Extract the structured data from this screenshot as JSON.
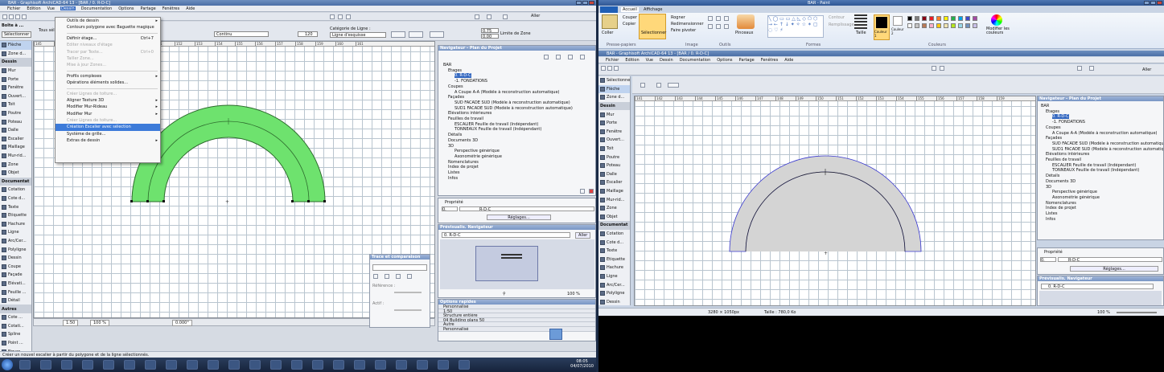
{
  "left_window": {
    "title": "BAR - Graphisoft ArchiCAD-64 13 - [BAR / 0. R-D-C]",
    "menu": [
      "Fichier",
      "Edition",
      "Vue",
      "Dessin",
      "Documentation",
      "Options",
      "Partage",
      "Fenêtres",
      "Aide"
    ],
    "active_menu": "Dessin",
    "infobox": {
      "title": "Boîte à ...",
      "select_btn": "Sélectionner",
      "tous_sele": "Tous séle",
      "line_type": "Continu",
      "thickness": "120",
      "category_label": "Catégorie de Ligne :",
      "category_value": "Ligne d'esquisse",
      "zone_limit": "Limite de Zone",
      "value_1": "0.75",
      "value_2": "0.00",
      "goto": "Aller"
    },
    "toolbox": [
      {
        "label": "Flèche",
        "type": "tool",
        "sel": true
      },
      {
        "label": "Zone d...",
        "type": "tool"
      },
      {
        "label": "Dessin",
        "type": "sec"
      },
      {
        "label": "Mur",
        "type": "tool"
      },
      {
        "label": "Porte",
        "type": "tool"
      },
      {
        "label": "Fenêtre",
        "type": "tool"
      },
      {
        "label": "Ouvert...",
        "type": "tool"
      },
      {
        "label": "Toit",
        "type": "tool"
      },
      {
        "label": "Poutre",
        "type": "tool"
      },
      {
        "label": "Poteau",
        "type": "tool"
      },
      {
        "label": "Dalle",
        "type": "tool"
      },
      {
        "label": "Escalier",
        "type": "tool"
      },
      {
        "label": "Maillage",
        "type": "tool"
      },
      {
        "label": "Mur-rid...",
        "type": "tool"
      },
      {
        "label": "Zone",
        "type": "tool"
      },
      {
        "label": "Objet",
        "type": "tool"
      },
      {
        "label": "Documentat",
        "type": "sec"
      },
      {
        "label": "Cotation",
        "type": "tool"
      },
      {
        "label": "Cote d...",
        "type": "tool"
      },
      {
        "label": "Texte",
        "type": "tool"
      },
      {
        "label": "Etiquette",
        "type": "tool"
      },
      {
        "label": "Hachure",
        "type": "tool"
      },
      {
        "label": "Ligne",
        "type": "tool"
      },
      {
        "label": "Arc/Cer...",
        "type": "tool"
      },
      {
        "label": "Polyligne",
        "type": "tool"
      },
      {
        "label": "Dessin",
        "type": "tool"
      },
      {
        "label": "Coupe",
        "type": "tool"
      },
      {
        "label": "Façade",
        "type": "tool"
      },
      {
        "label": "Elévati...",
        "type": "tool"
      },
      {
        "label": "Feuille ...",
        "type": "tool"
      },
      {
        "label": "Détail",
        "type": "tool"
      },
      {
        "label": "Autres",
        "type": "sec"
      },
      {
        "label": "Cote ...",
        "type": "tool"
      },
      {
        "label": "Cotati...",
        "type": "tool"
      },
      {
        "label": "Spline",
        "type": "tool"
      },
      {
        "label": "Point ...",
        "type": "tool"
      },
      {
        "label": "Figure",
        "type": "tool"
      }
    ],
    "dropdown": [
      {
        "label": "Outils de dessin",
        "arrow": true
      },
      {
        "label": "Contours polygone avec Baguette magique"
      },
      {
        "sep": true
      },
      {
        "label": "Définir étage...",
        "key": "Ctrl+7"
      },
      {
        "label": "Editer niveaux d'étage",
        "dis": true
      },
      {
        "label": "Tracer par Texte...",
        "key": "Ctrl+0",
        "dis": true
      },
      {
        "label": "Tailler Zone...",
        "dis": true
      },
      {
        "label": "Mise à jour Zones...",
        "dis": true
      },
      {
        "sep": true
      },
      {
        "label": "Profils complexes",
        "arrow": true
      },
      {
        "label": "Opérations éléments solides..."
      },
      {
        "sep": true
      },
      {
        "label": "Créer Lignes de toiture...",
        "dis": true
      },
      {
        "label": "Aligner Texture 3D",
        "arrow": true
      },
      {
        "label": "Modifier Mur-Rideau",
        "arrow": true
      },
      {
        "label": "Modifier Mur",
        "arrow": true
      },
      {
        "label": "Créer Lignes de toiture...",
        "dis": true
      },
      {
        "label": "Création Escalier avec sélection",
        "hl": true
      },
      {
        "label": "Système de grille..."
      },
      {
        "label": "Extras de dessin",
        "arrow": true
      }
    ],
    "ruler": [
      "145",
      "146",
      "147",
      "148",
      "149",
      "150",
      "151",
      "152",
      "153",
      "154",
      "155",
      "156",
      "157",
      "158",
      "159",
      "160",
      "161"
    ],
    "navigator_title": "Navigateur - Plan du Projet",
    "tree": [
      {
        "t": "BAR",
        "l": 0
      },
      {
        "t": "Etages",
        "l": 1
      },
      {
        "t": "0. R-D-C",
        "l": 2,
        "hl": true
      },
      {
        "t": "-1. FONDATIONS",
        "l": 2
      },
      {
        "t": "Coupes",
        "l": 1
      },
      {
        "t": "A Coupe A-A (Modèle à reconstruction automatique)",
        "l": 2
      },
      {
        "t": "Façades",
        "l": 1
      },
      {
        "t": "SUD FACADE SUD (Modèle à reconstruction automatique)",
        "l": 2
      },
      {
        "t": "SUD1 FACADE SUD (Modèle à reconstruction automatique)",
        "l": 2
      },
      {
        "t": "Elévations intérieures",
        "l": 1
      },
      {
        "t": "Feuilles de travail",
        "l": 1
      },
      {
        "t": "ESCALIER Feuille de travail (Indépendant)",
        "l": 2
      },
      {
        "t": "TONNEAUX Feuille de travail (Indépendant)",
        "l": 2
      },
      {
        "t": "Détails",
        "l": 1
      },
      {
        "t": "Documents 3D",
        "l": 1
      },
      {
        "t": "3D",
        "l": 1
      },
      {
        "t": "Perspective générique",
        "l": 2
      },
      {
        "t": "Axonométrie générique",
        "l": 2
      },
      {
        "t": "Nomenclatures",
        "l": 1
      },
      {
        "t": "Index de projet",
        "l": 1
      },
      {
        "t": "Listes",
        "l": 1
      },
      {
        "t": "Infos",
        "l": 1
      }
    ],
    "properties": {
      "title": "Propriété",
      "name": "R-D-C",
      "floor": "0.",
      "settings_btn": "Réglages..."
    },
    "preview": {
      "title": "Prévisualis. Navigateur",
      "value": "0. R-D-C",
      "goto": "Aller",
      "zoom": "100 %"
    },
    "quick_options": {
      "title": "Options rapides",
      "rows": [
        "Personnalisé",
        "1:50",
        "Structure entière",
        "04 Building plans 50",
        "Autre",
        "Personnalisé"
      ]
    },
    "trace": {
      "title": "Trace et comparaison",
      "ref": "Référence :",
      "actif": "Actif :"
    },
    "bottom": {
      "scale": "1:50",
      "zoom": "100 %",
      "angle": "0.000°"
    },
    "status": "Créer un nouvel escalier à partir du polygone et de la ligne sélectionnés.",
    "clock_time": "08:05",
    "clock_date": "04/07/2010",
    "colors": {
      "arch_fill": "#6ee26e",
      "arch_stroke": "#2d6b2d",
      "accent": "#3d7bd9"
    }
  },
  "right_window": {
    "paint_title": "BAR - Paint",
    "ribbon_tabs": [
      "Accueil",
      "Affichage"
    ],
    "ribbon": {
      "paste": "Coller",
      "copy": "Copier",
      "cut": "Couper",
      "select": "Sélectionner",
      "crop": "Rogner",
      "resize": "Redimensionner",
      "rotate": "Faire pivoter",
      "brushes": "Pinceaux",
      "outline": "Contour",
      "fill": "Remplissage",
      "size": "Taille",
      "color1": "Couleur 1",
      "color2": "Couleur 2",
      "edit_colors": "Modifier les couleurs",
      "groups": [
        "Presse-papiers",
        "Image",
        "Outils",
        "Formes",
        "Couleurs"
      ]
    },
    "swatches": [
      "#000000",
      "#7f7f7f",
      "#880015",
      "#ed1c24",
      "#ff7f27",
      "#fff200",
      "#22b14c",
      "#00a2e8",
      "#3f48cc",
      "#a349a4",
      "#ffffff",
      "#c3c3c3",
      "#b97a57",
      "#ffaec9",
      "#ffc90e",
      "#efe4b0",
      "#b5e61d",
      "#99d9ea",
      "#7092be",
      "#c8bfe7"
    ],
    "archicad_title": "BAR - Graphisoft ArchiCAD-64 13 - [BAR / 0. R-D-C]",
    "menu": [
      "Fichier",
      "Edition",
      "Vue",
      "Dessin",
      "Documentation",
      "Options",
      "Partage",
      "Fenêtres",
      "Aide"
    ],
    "goto": "Aller",
    "toolbox": [
      {
        "label": "Sélectionner",
        "type": "tool"
      },
      {
        "label": "Flèche",
        "type": "tool",
        "sel": true
      },
      {
        "label": "Zone d...",
        "type": "tool"
      },
      {
        "label": "Dessin",
        "type": "sec"
      },
      {
        "label": "Mur",
        "type": "tool"
      },
      {
        "label": "Porte",
        "type": "tool"
      },
      {
        "label": "Fenêtre",
        "type": "tool"
      },
      {
        "label": "Ouvert...",
        "type": "tool"
      },
      {
        "label": "Toit",
        "type": "tool"
      },
      {
        "label": "Poutre",
        "type": "tool"
      },
      {
        "label": "Poteau",
        "type": "tool"
      },
      {
        "label": "Dalle",
        "type": "tool"
      },
      {
        "label": "Escalier",
        "type": "tool"
      },
      {
        "label": "Maillage",
        "type": "tool"
      },
      {
        "label": "Mur-rid...",
        "type": "tool"
      },
      {
        "label": "Zone",
        "type": "tool"
      },
      {
        "label": "Objet",
        "type": "tool"
      },
      {
        "label": "Documentat",
        "type": "sec"
      },
      {
        "label": "Cotation",
        "type": "tool"
      },
      {
        "label": "Cote d...",
        "type": "tool"
      },
      {
        "label": "Texte",
        "type": "tool"
      },
      {
        "label": "Etiquette",
        "type": "tool"
      },
      {
        "label": "Hachure",
        "type": "tool"
      },
      {
        "label": "Ligne",
        "type": "tool"
      },
      {
        "label": "Arc/Cer...",
        "type": "tool"
      },
      {
        "label": "Polyligne",
        "type": "tool"
      },
      {
        "label": "Dessin",
        "type": "tool"
      }
    ],
    "ruler": [
      "141",
      "142",
      "143",
      "144",
      "145",
      "146",
      "147",
      "148",
      "149",
      "150",
      "151",
      "152",
      "153",
      "154",
      "155",
      "156",
      "157",
      "158",
      "159"
    ],
    "navigator_title": "Navigateur - Plan du Projet",
    "tree": [
      {
        "t": "BAR",
        "l": 0
      },
      {
        "t": "Etages",
        "l": 1
      },
      {
        "t": "0. R-D-C",
        "l": 2,
        "hl": true
      },
      {
        "t": "-1. FONDATIONS",
        "l": 2
      },
      {
        "t": "Coupes",
        "l": 1
      },
      {
        "t": "A Coupe A-A (Modèle à reconstruction automatique)",
        "l": 2
      },
      {
        "t": "Façades",
        "l": 1
      },
      {
        "t": "SUD FACADE SUD (Modèle à reconstruction automatique)",
        "l": 2
      },
      {
        "t": "SUD1 FACADE SUD (Modèle à reconstruction automatique)",
        "l": 2
      },
      {
        "t": "Elévations intérieures",
        "l": 1
      },
      {
        "t": "Feuilles de travail",
        "l": 1
      },
      {
        "t": "ESCALIER Feuille de travail (Indépendant)",
        "l": 2
      },
      {
        "t": "TONNEAUX Feuille de travail (Indépendant)",
        "l": 2
      },
      {
        "t": "Détails",
        "l": 1
      },
      {
        "t": "Documents 3D",
        "l": 1
      },
      {
        "t": "3D",
        "l": 1
      },
      {
        "t": "Perspective générique",
        "l": 2
      },
      {
        "t": "Axonométrie générique",
        "l": 2
      },
      {
        "t": "Nomenclatures",
        "l": 1
      },
      {
        "t": "Index de projet",
        "l": 1
      },
      {
        "t": "Listes",
        "l": 1
      },
      {
        "t": "Infos",
        "l": 1
      }
    ],
    "properties": {
      "title": "Propriété",
      "name": "R-D-C",
      "floor": "0.",
      "settings_btn": "Réglages..."
    },
    "preview": {
      "title": "Prévisualis. Navigateur",
      "value": "0. R-D-C"
    },
    "status": {
      "dims": "3280 × 1050px",
      "size": "Taille : 780,0 Ko",
      "zoom": "100 %"
    },
    "colors": {
      "arch_fill": "#d4d4d4",
      "arch_stroke": "#3a3ad0"
    }
  }
}
